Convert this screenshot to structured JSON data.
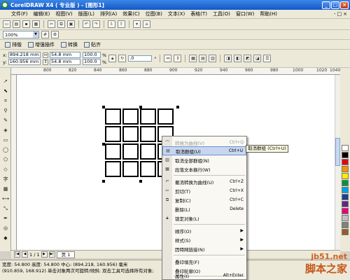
{
  "window": {
    "title": "CorelDRAW X4 ( 专业版 ) - [图形1]",
    "buttons": [
      "_",
      "□",
      "×"
    ]
  },
  "menubar": {
    "items": [
      "文件(F)",
      "编辑(E)",
      "视图(V)",
      "版面(L)",
      "排列(A)",
      "效果(C)",
      "位图(B)",
      "文本(X)",
      "表格(T)",
      "工具(O)",
      "窗口(W)",
      "帮助(H)"
    ],
    "doc_controls": [
      "-",
      "□",
      "×"
    ]
  },
  "toolbar_zoom": {
    "zoom_value": "100%"
  },
  "plugin_toolbar": {
    "items": [
      "排版",
      "增强插件",
      "转换",
      "贴齐"
    ]
  },
  "property_bar": {
    "x_label": "x:",
    "x_value": "894.218 mm",
    "y_label": "y:",
    "y_value": "160.956 mm",
    "w_value": "54.8 mm",
    "h_value": "54.8 mm",
    "scale_x": "100.0",
    "scale_y": "100.0",
    "percent": "%",
    "rotation": ".0",
    "rotation_unit": "°"
  },
  "ruler": {
    "labels": [
      "800",
      "820",
      "840",
      "860",
      "880",
      "900",
      "920",
      "940",
      "960",
      "980",
      "1000",
      "1020",
      "1040"
    ],
    "unit": "毫米"
  },
  "context_menu": {
    "items": [
      {
        "icon": "convert-curve-icon",
        "label": "转换为曲线(V)",
        "key": "Ctrl+Q",
        "disabled": true
      },
      {
        "icon": "ungroup-icon",
        "label": "取消群组(U)",
        "key": "Ctrl+U",
        "highlighted": true
      },
      {
        "icon": "ungroup-all-icon",
        "label": "取消全部群组(N)",
        "key": ""
      },
      {
        "icon": "text-wrap-icon",
        "label": "段落文本换行(W)",
        "key": ""
      },
      {
        "icon": "undo-icon",
        "label": "撤消转换为曲线(U)",
        "key": "Ctrl+Z"
      },
      {
        "icon": "cut-icon",
        "label": "剪切(T)",
        "key": "Ctrl+X"
      },
      {
        "icon": "copy-icon",
        "label": "复制(C)",
        "key": "Ctrl+C"
      },
      {
        "icon": "delete-icon",
        "label": "删除(L)",
        "key": "Delete"
      },
      {
        "icon": "lock-icon",
        "label": "锁定对象(L)",
        "key": ""
      },
      {
        "icon": "",
        "label": "顺序(O)",
        "key": "",
        "submenu": true
      },
      {
        "icon": "",
        "label": "样式(S)",
        "key": "",
        "submenu": true
      },
      {
        "icon": "",
        "label": "因特网链接(N)",
        "key": "",
        "submenu": true
      },
      {
        "icon": "",
        "label": "叠印填充(F)",
        "key": ""
      },
      {
        "icon": "",
        "label": "叠印轮廓(O)",
        "key": ""
      },
      {
        "icon": "",
        "label": "属性(I)",
        "key": "Alt+Enter"
      }
    ]
  },
  "tooltip": "取消群组 (Ctrl+U)",
  "pagebar": {
    "position": "1 / 1",
    "page_tab": "页 1"
  },
  "statusbar": {
    "line1": "宽度: 54.800  高度: 54.800  中心: (894.218, 160.956)  毫米",
    "line2": "(910.859, 168.912)     单击对象两次可旋转/倾斜; 双击工具可选择所有对象;"
  },
  "palette_colors": [
    "#ffffff",
    "#000000",
    "#e30613",
    "#f29400",
    "#ffed00",
    "#00963f",
    "#00a0e3",
    "#1d3f93",
    "#662483",
    "#e6007e",
    "#c0c0c0",
    "#808080",
    "#9a5b2a"
  ],
  "watermark": {
    "url": "jb51.net",
    "cn": "脚本之家"
  }
}
